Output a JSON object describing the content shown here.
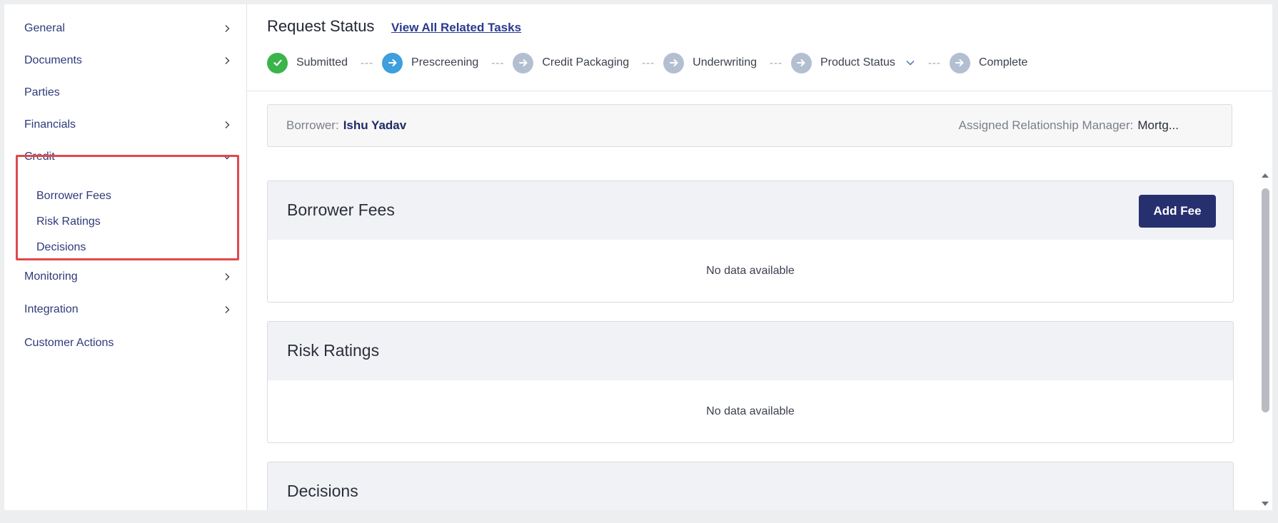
{
  "sidebar": {
    "items": [
      {
        "label": "General"
      },
      {
        "label": "Documents"
      },
      {
        "label": "Parties"
      },
      {
        "label": "Financials"
      },
      {
        "label": "Credit"
      },
      {
        "label": "Monitoring"
      },
      {
        "label": "Integration"
      },
      {
        "label": "Customer Actions"
      }
    ],
    "credit_subitems": [
      {
        "label": "Borrower Fees"
      },
      {
        "label": "Risk Ratings"
      },
      {
        "label": "Decisions"
      }
    ]
  },
  "header": {
    "title": "Request Status",
    "related_link": "View All Related Tasks"
  },
  "stepper": {
    "steps": [
      {
        "label": "Submitted",
        "state": "complete"
      },
      {
        "label": "Prescreening",
        "state": "current"
      },
      {
        "label": "Credit Packaging",
        "state": "pending"
      },
      {
        "label": "Underwriting",
        "state": "pending"
      },
      {
        "label": "Product Status",
        "state": "pending"
      },
      {
        "label": "Complete",
        "state": "pending"
      }
    ],
    "separator": "---"
  },
  "info": {
    "borrower_label": "Borrower:",
    "borrower_value": "Ishu Yadav",
    "manager_label": "Assigned Relationship Manager:",
    "manager_value": "Mortg..."
  },
  "cards": {
    "borrower_fees": {
      "title": "Borrower Fees",
      "empty": "No data available",
      "button": "Add Fee"
    },
    "risk_ratings": {
      "title": "Risk Ratings",
      "empty": "No data available"
    },
    "decisions": {
      "title": "Decisions"
    }
  },
  "colors": {
    "complete": "#3bb44a",
    "current": "#3d9fdc",
    "pending": "#b3bfd1",
    "accent": "#27306f",
    "highlight": "#e0484d"
  },
  "icons": {
    "nav_chevron": "chevron-right-icon",
    "nav_expanded": "chevron-down-icon",
    "step_complete": "check-icon",
    "step_arrow": "arrow-right-icon"
  }
}
